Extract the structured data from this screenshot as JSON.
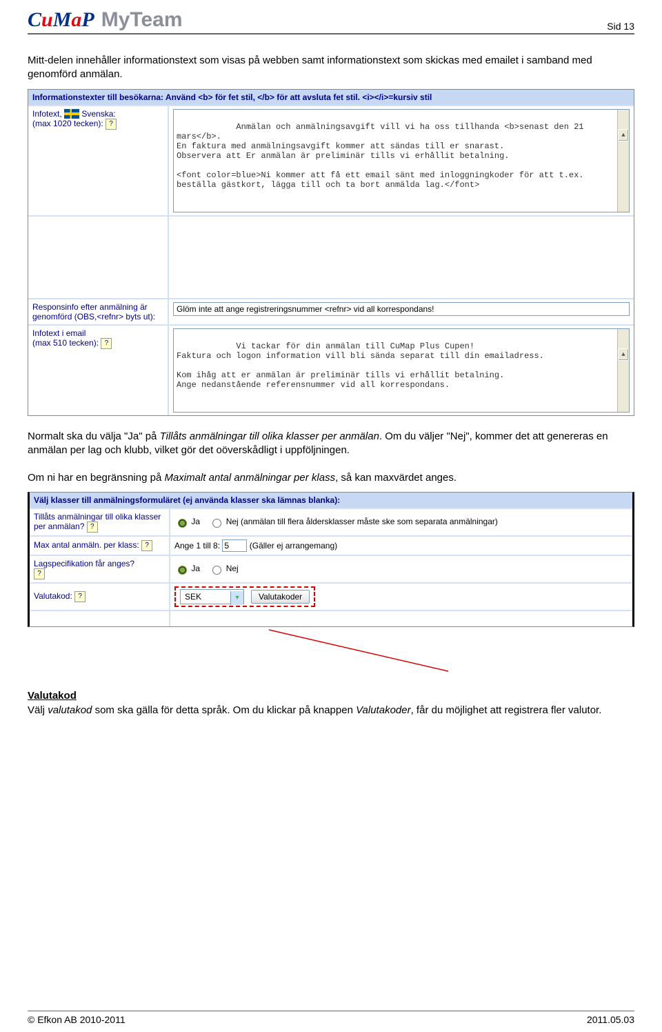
{
  "pagenum": "Sid 13",
  "brand": {
    "cumap_c": "C",
    "cumap_u": "u",
    "cumap_m": "M",
    "cumap_a": "a",
    "cumap_p": "P",
    "myteam": "MyTeam"
  },
  "intro_before": "Mitt-delen innehåller informationstext som visas på webben samt informationstext som skickas med emailet i samband med genomförd anmälan.",
  "shot1": {
    "header": "Informationstexter till besökarna:  Använd <b> för fet stil, </b> för att avsluta fet stil.  <i></i>=kursiv stil",
    "row1": {
      "label_line1": "Infotext, ",
      "label_lang": "Svenska:",
      "label_line2": "(max 1020 tecken):",
      "text": "Anmälan och anmälningsavgift vill vi ha oss tillhanda <b>senast den 21 mars</b>.\nEn faktura med anmälningsavgift kommer att sändas till er snarast.\nObservera att Er anmälan är preliminär tills vi erhållit betalning.\n\n<font color=blue>Ni kommer att få ett email sänt med inloggningkoder för att t.ex. beställa gästkort, lägga till och ta bort anmälda lag.</font>"
    },
    "row2": {
      "label": "Responsinfo efter anmälning är genomförd (OBS,<refnr> byts ut):",
      "value": "Glöm inte att ange registreringsnummer <refnr> vid all korrespondans!"
    },
    "row3": {
      "label_line1": "Infotext i email",
      "label_line2": "(max 510 tecken):",
      "text": "Vi tackar för din anmälan till CuMap Plus Cupen!\nFaktura och logon information vill bli sända separat till din emailadress.\n\nKom ihåg att er anmälan är preliminär tills vi erhållit betalning.\nAnge nedanstående referensnummer vid all korrespondans."
    }
  },
  "mid1": "Normalt ska du välja \"Ja\" på ",
  "mid1_em": "Tillåts anmälningar till olika klasser per anmälan",
  "mid1_tail": ". Om du väljer \"Nej\", kommer det att genereras en anmälan per lag och klubb, vilket gör det oöverskådligt i uppföljningen.",
  "mid2_a": "Om ni har en begränsning på ",
  "mid2_em": "Maximalt antal anmälningar per klass",
  "mid2_b": ", så kan maxvärdet anges.",
  "shot2": {
    "header": "Välj klasser till anmälningsformuläret (ej använda klasser ska lämnas blanka):",
    "r1_label": "Tillåts anmälningar till olika klasser per anmälan?",
    "r1_ja": "Ja",
    "r1_nej": "Nej (anmälan till flera åldersklasser måste ske som separata anmälningar)",
    "r2_label": "Max antal anmäln. per klass:",
    "r2_text_a": "Ange 1 till 8:",
    "r2_val": "5",
    "r2_text_b": "(Gäller ej arrangemang)",
    "r3_label": "Lagspecifikation får anges?",
    "r3_ja": "Ja",
    "r3_nej": "Nej",
    "r4_label": "Valutakod:",
    "r4_combo": "SEK",
    "r4_button": "Valutakoder"
  },
  "bottom_h": "Valutakod",
  "bottom_a": "Välj ",
  "bottom_em": "valutakod",
  "bottom_b": " som ska gälla för detta språk. Om du klickar på knappen ",
  "bottom_em2": "Valutakoder",
  "bottom_c": ", får du möjlighet att registrera fler valutor.",
  "footer_left": "© Efkon AB 2010-2011",
  "footer_right": "2011.05.03",
  "help_symbol": "?"
}
